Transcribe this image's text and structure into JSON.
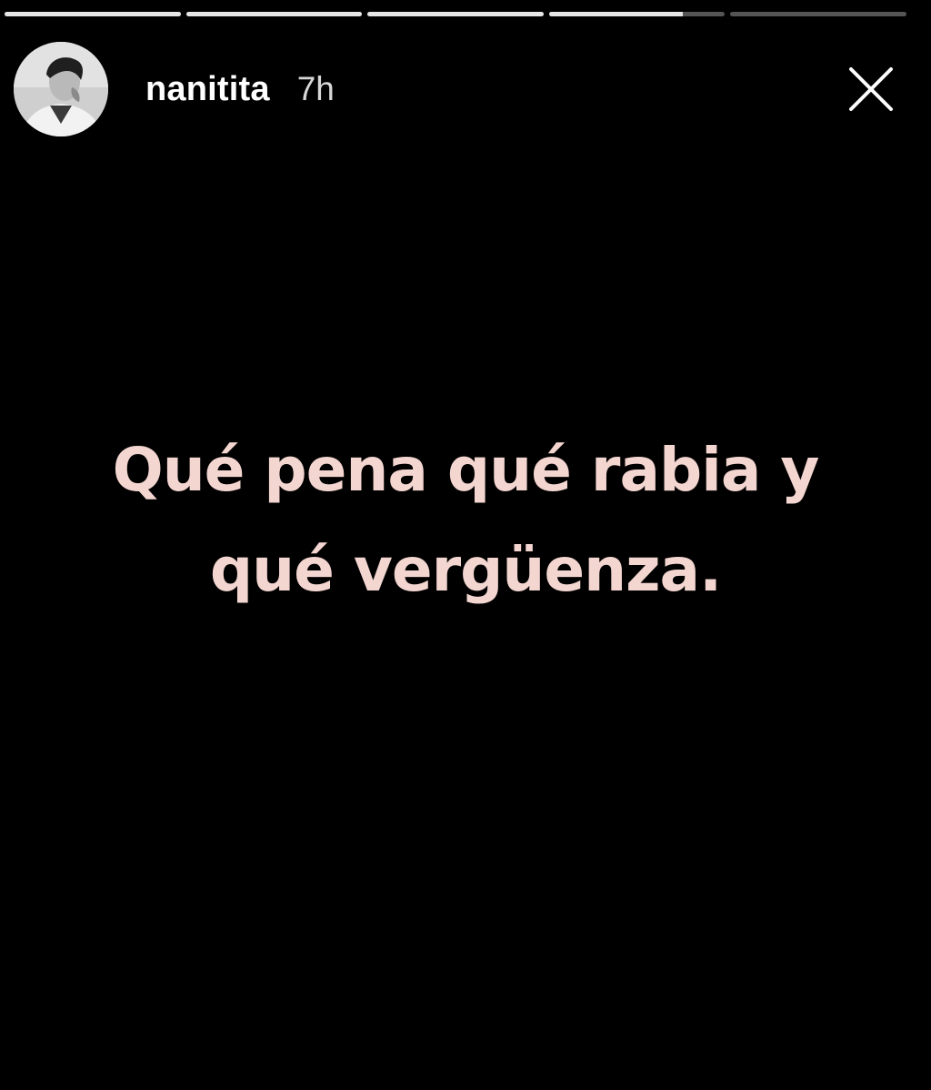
{
  "story": {
    "progress": [
      1,
      1,
      1,
      0.76,
      0
    ],
    "username": "nanitita",
    "time": "7h",
    "text": "Qué pena qué rabia y qué vergüenza."
  },
  "icons": {
    "avatar": "profile-photo",
    "close": "close-icon"
  },
  "colors": {
    "background": "#000000",
    "text": "#f4d6d1",
    "progress_done": "#e6e6e6",
    "progress_pending": "#555555"
  }
}
